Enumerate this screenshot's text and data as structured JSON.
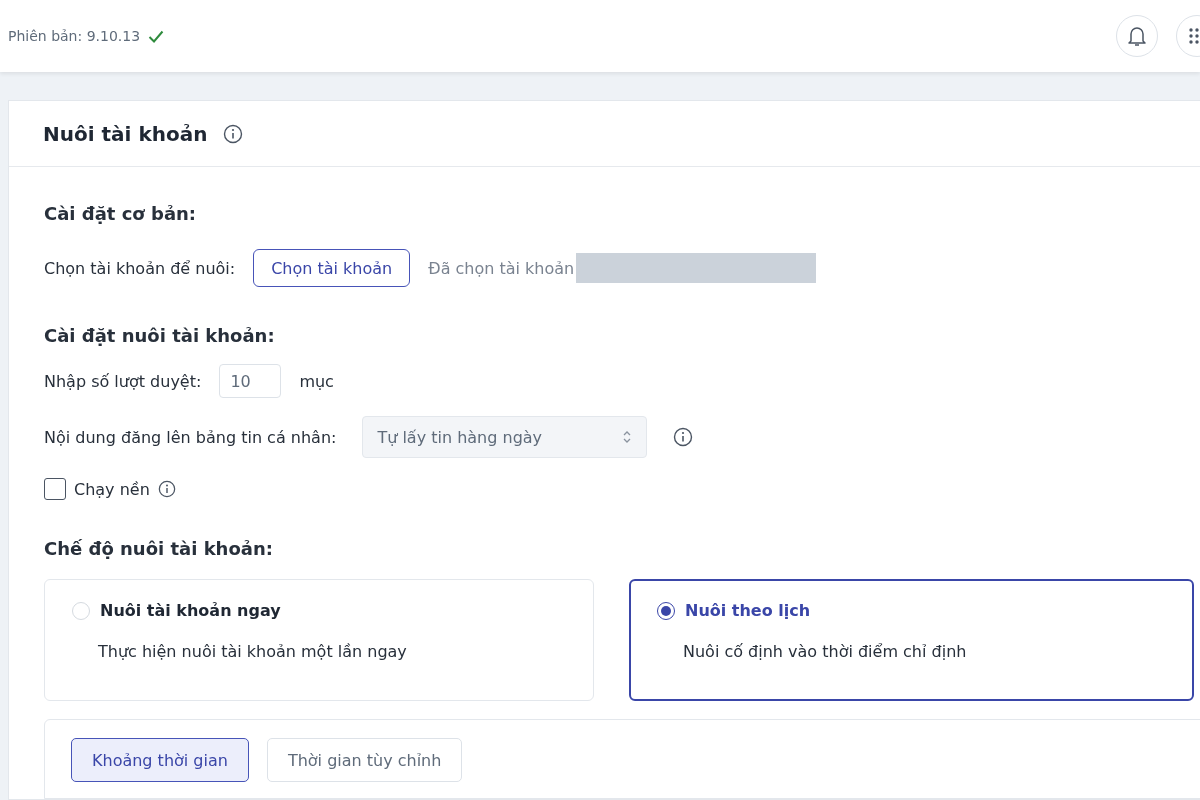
{
  "header": {
    "version": "Phiên bản: 9.10.13",
    "verified": true
  },
  "page": {
    "title": "Nuôi tài khoản"
  },
  "basic": {
    "heading": "Cài đặt cơ bản:",
    "label": "Chọn tài khoản để nuôi:",
    "button": "Chọn tài khoản",
    "status": "Đã chọn tài khoản"
  },
  "settings": {
    "heading": "Cài đặt nuôi tài khoản:",
    "views_label": "Nhập số lượt duyệt:",
    "views_value": "10",
    "views_unit": "mục",
    "content_label": "Nội dung đăng lên bảng tin cá nhân:",
    "content_value": "Tự lấy tin hàng ngày",
    "background_label": "Chạy nền",
    "background_checked": false
  },
  "mode": {
    "heading": "Chế độ nuôi tài khoản:",
    "options": [
      {
        "title": "Nuôi tài khoản ngay",
        "description": "Thực hiện nuôi tài khoản một lần ngay",
        "selected": false
      },
      {
        "title": "Nuôi theo lịch",
        "description": "Nuôi cố định vào thời điểm chỉ định",
        "selected": true
      }
    ]
  },
  "schedule_tabs": [
    {
      "label": "Khoảng thời gian",
      "selected": true
    },
    {
      "label": "Thời gian tùy chỉnh",
      "selected": false
    }
  ]
}
